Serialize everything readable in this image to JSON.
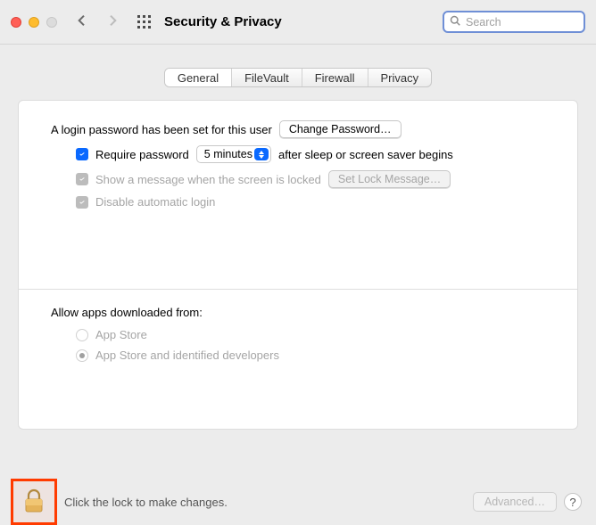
{
  "header": {
    "title": "Security & Privacy",
    "search_placeholder": "Search"
  },
  "tabs": [
    {
      "label": "General",
      "active": true
    },
    {
      "label": "FileVault",
      "active": false
    },
    {
      "label": "Firewall",
      "active": false
    },
    {
      "label": "Privacy",
      "active": false
    }
  ],
  "general": {
    "password_set_text": "A login password has been set for this user",
    "change_password_btn": "Change Password…",
    "require_password_label": "Require password",
    "require_password_checked": true,
    "delay_value": "5 minutes",
    "after_sleep_text": "after sleep or screen saver begins",
    "show_message_label": "Show a message when the screen is locked",
    "show_message_checked": true,
    "set_lock_message_btn": "Set Lock Message…",
    "disable_auto_login_label": "Disable automatic login",
    "disable_auto_login_checked": true
  },
  "gatekeeper": {
    "section_label": "Allow apps downloaded from:",
    "options": [
      {
        "label": "App Store",
        "selected": false
      },
      {
        "label": "App Store and identified developers",
        "selected": true
      }
    ]
  },
  "bottom": {
    "lock_text": "Click the lock to make changes.",
    "advanced_btn": "Advanced…",
    "help": "?"
  }
}
